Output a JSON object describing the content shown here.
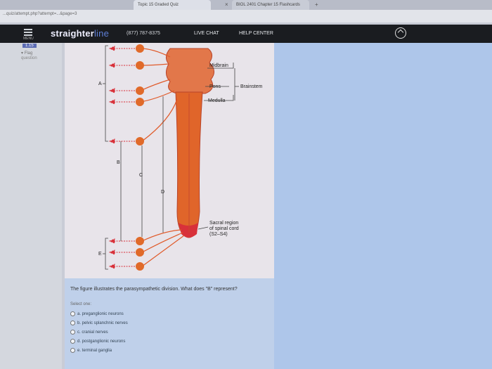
{
  "browser": {
    "tabs": [
      {
        "label": "Topic 15 Graded Quiz"
      },
      {
        "label": "BIOL 2401 Chapter 15 Flashcards"
      }
    ],
    "new_tab_label": "+",
    "address": "...quiz/attempt.php?attempt=...&page=3"
  },
  "nav": {
    "brand_main": "straighter",
    "brand_line": "line",
    "phone": "(877) 787-8375",
    "live_chat": "LIVE CHAT",
    "help_center": "HELP CENTER",
    "menu_label": "MENU"
  },
  "sidebar": {
    "question_tag": "1.15",
    "flag_label": "Flag",
    "flag_sub": "question"
  },
  "figure": {
    "labels": {
      "midbrain": "Midbrain",
      "pons": "Pons",
      "medulla": "Medulla",
      "brainstem": "Brainstem",
      "sacral_1": "Sacral region",
      "sacral_2": "of spinal cord",
      "sacral_3": "(S2–S4)",
      "a": "A",
      "b": "B",
      "c": "C",
      "d": "D",
      "e": "E"
    }
  },
  "question": {
    "text": "The figure illustrates the parasympathetic division. What does \"B\" represent?",
    "select_one": "Select one:",
    "options": [
      "a. preganglionic neurons",
      "b. pelvic splanchnic nerves",
      "c. cranial nerves",
      "d. postganglionic neurons",
      "e. terminal ganglia"
    ]
  },
  "colors": {
    "navbar": "#1a1c20",
    "accent": "#5f7fd6",
    "spinal_cord": "#e0652a",
    "ganglion": "#e06a2a"
  }
}
